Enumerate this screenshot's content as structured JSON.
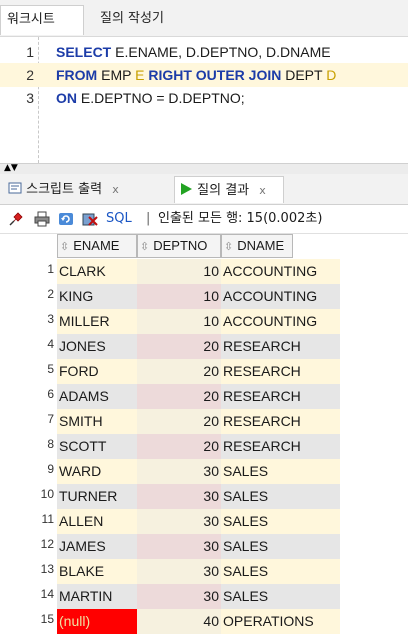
{
  "editor_tabs": {
    "worksheet": "워크시트",
    "query_builder": "질의 작성기"
  },
  "sql_lines": [
    {
      "num": "1",
      "parts": [
        {
          "t": "SELECT",
          "c": "kw"
        },
        {
          "t": " E.ENAME, D.DEPTNO, D.DNAME",
          "c": "tx"
        }
      ]
    },
    {
      "num": "2",
      "parts": [
        {
          "t": "FROM",
          "c": "kw"
        },
        {
          "t": " EMP ",
          "c": "tx"
        },
        {
          "t": "E",
          "c": "al"
        },
        {
          "t": " RIGHT OUTER JOIN",
          "c": "kw"
        },
        {
          "t": " DEPT ",
          "c": "tx"
        },
        {
          "t": "D",
          "c": "al"
        }
      ]
    },
    {
      "num": "3",
      "parts": [
        {
          "t": "ON",
          "c": "kw"
        },
        {
          "t": " E.DEPTNO = D.DEPTNO;",
          "c": "tx"
        }
      ]
    }
  ],
  "result_tabs": {
    "script_output": "스크립트 출력",
    "query_result": "질의 결과",
    "close": "x"
  },
  "toolbar": {
    "sql_label": "SQL",
    "separator": "|",
    "status": "인출된 모든 행: 15(0.002초)"
  },
  "grid": {
    "columns": [
      "ENAME",
      "DEPTNO",
      "DNAME"
    ],
    "rows": [
      {
        "n": "1",
        "ename": "CLARK",
        "deptno": "10",
        "dname": "ACCOUNTING"
      },
      {
        "n": "2",
        "ename": "KING",
        "deptno": "10",
        "dname": "ACCOUNTING"
      },
      {
        "n": "3",
        "ename": "MILLER",
        "deptno": "10",
        "dname": "ACCOUNTING"
      },
      {
        "n": "4",
        "ename": "JONES",
        "deptno": "20",
        "dname": "RESEARCH"
      },
      {
        "n": "5",
        "ename": "FORD",
        "deptno": "20",
        "dname": "RESEARCH"
      },
      {
        "n": "6",
        "ename": "ADAMS",
        "deptno": "20",
        "dname": "RESEARCH"
      },
      {
        "n": "7",
        "ename": "SMITH",
        "deptno": "20",
        "dname": "RESEARCH"
      },
      {
        "n": "8",
        "ename": "SCOTT",
        "deptno": "20",
        "dname": "RESEARCH"
      },
      {
        "n": "9",
        "ename": "WARD",
        "deptno": "30",
        "dname": "SALES"
      },
      {
        "n": "10",
        "ename": "TURNER",
        "deptno": "30",
        "dname": "SALES"
      },
      {
        "n": "11",
        "ename": "ALLEN",
        "deptno": "30",
        "dname": "SALES"
      },
      {
        "n": "12",
        "ename": "JAMES",
        "deptno": "30",
        "dname": "SALES"
      },
      {
        "n": "13",
        "ename": "BLAKE",
        "deptno": "30",
        "dname": "SALES"
      },
      {
        "n": "14",
        "ename": "MARTIN",
        "deptno": "30",
        "dname": "SALES"
      },
      {
        "n": "15",
        "ename": "(null)",
        "deptno": "40",
        "dname": "OPERATIONS"
      }
    ]
  },
  "colors": {
    "keyword": "#1c3ca8",
    "alias": "#c8a000",
    "null_cell": "#ff0000",
    "row_highlight": "#fff7dc"
  },
  "icons": [
    "pin-icon",
    "print-icon",
    "refresh-icon",
    "export-icon",
    "run-icon"
  ]
}
